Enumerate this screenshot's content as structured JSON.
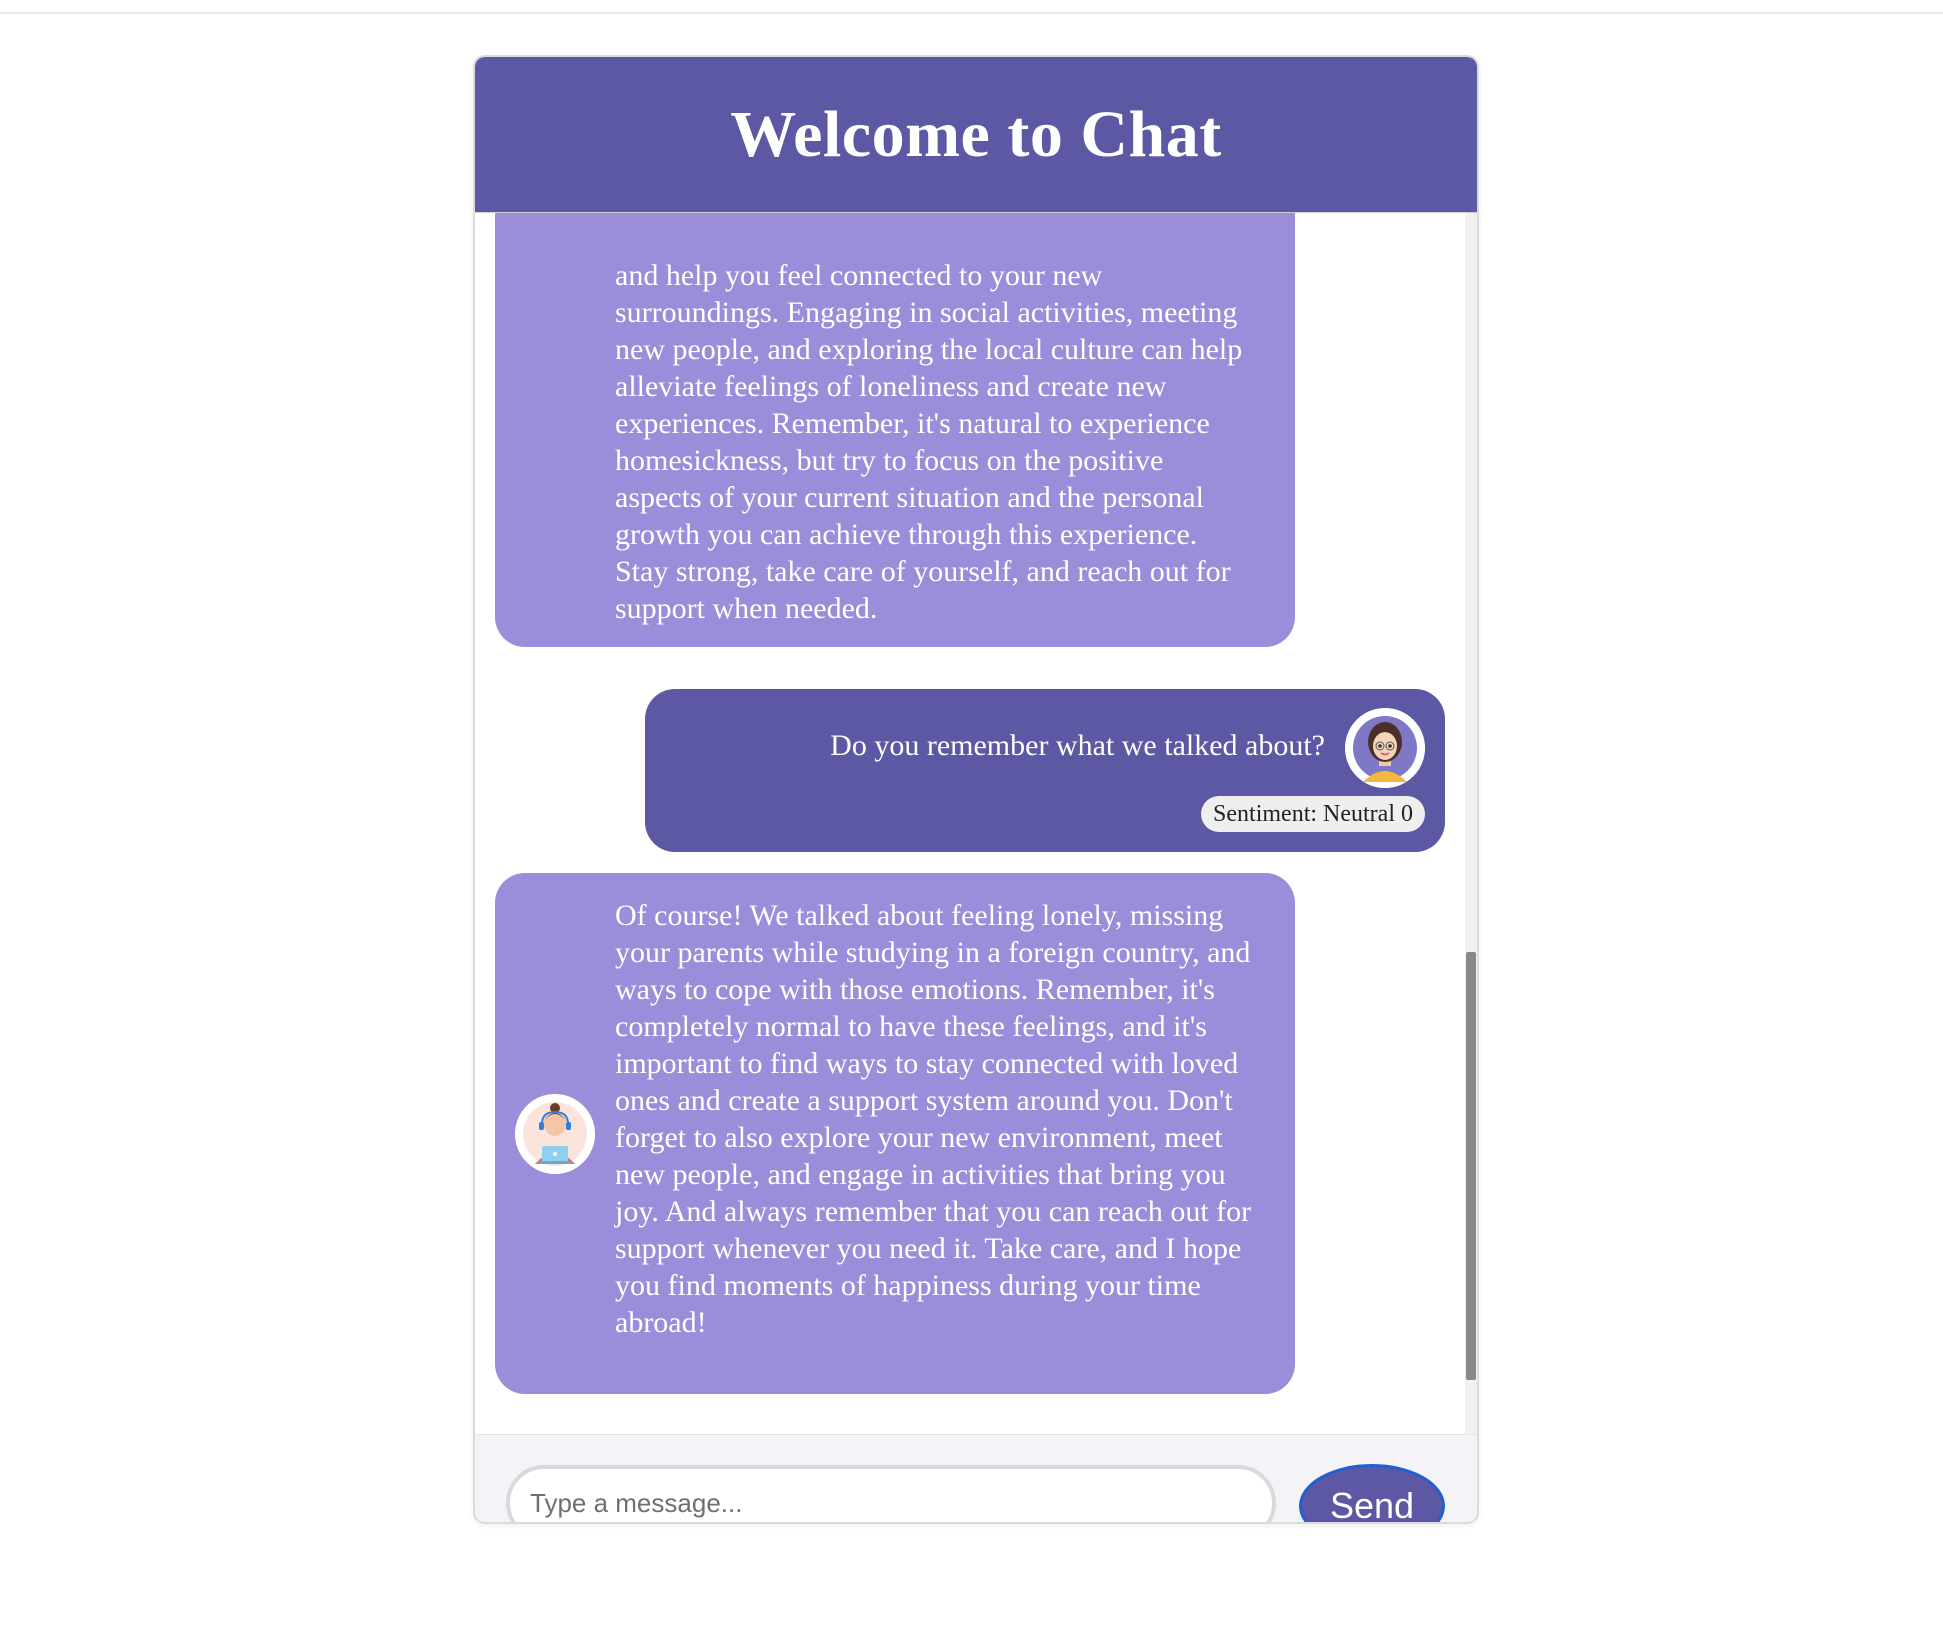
{
  "header": {
    "title": "Welcome to Chat"
  },
  "messages": [
    {
      "sender": "bot",
      "text": "and help you feel connected to your new surroundings. Engaging in social activities, meeting new people, and exploring the local culture can help alleviate feelings of loneliness and create new experiences. Remember, it's natural to experience homesickness, but try to focus on the positive aspects of your current situation and the personal growth you can achieve through this experience. Stay strong, take care of yourself, and reach out for support when needed."
    },
    {
      "sender": "user",
      "text": "Do you remember what we talked about?",
      "sentiment": "Sentiment: Neutral 0"
    },
    {
      "sender": "bot",
      "text": "Of course! We talked about feeling lonely, missing your parents while studying in a foreign country, and ways to cope with those emotions. Remember, it's completely normal to have these feelings, and it's important to find ways to stay connected with loved ones and create a support system around you. Don't forget to also explore your new environment, meet new people, and engage in activities that bring you joy. And always remember that you can reach out for support whenever you need it. Take care, and I hope you find moments of happiness during your time abroad!"
    }
  ],
  "input": {
    "placeholder": "Type a message...",
    "value": ""
  },
  "send_label": "Send",
  "icons": {
    "user_avatar": "user-avatar-icon",
    "bot_avatar": "bot-avatar-icon"
  },
  "colors": {
    "header": "#5c58a3",
    "bot_bubble": "#9b8dd9",
    "user_bubble": "#5c58a3",
    "send_button": "#5c58a3",
    "send_border": "#1f5fd0"
  }
}
